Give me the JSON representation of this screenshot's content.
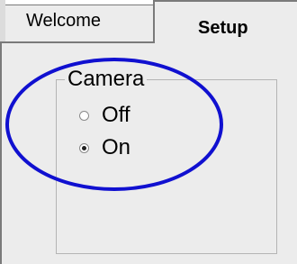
{
  "tabs": [
    {
      "label": "Welcome",
      "selected": false
    },
    {
      "label": "Setup",
      "selected": true
    }
  ],
  "camera_group": {
    "title": "Camera",
    "options": [
      {
        "label": "Off",
        "checked": false
      },
      {
        "label": "On",
        "checked": true
      }
    ]
  },
  "annotation": {
    "shape": "ellipse",
    "color": "#1010d0"
  }
}
